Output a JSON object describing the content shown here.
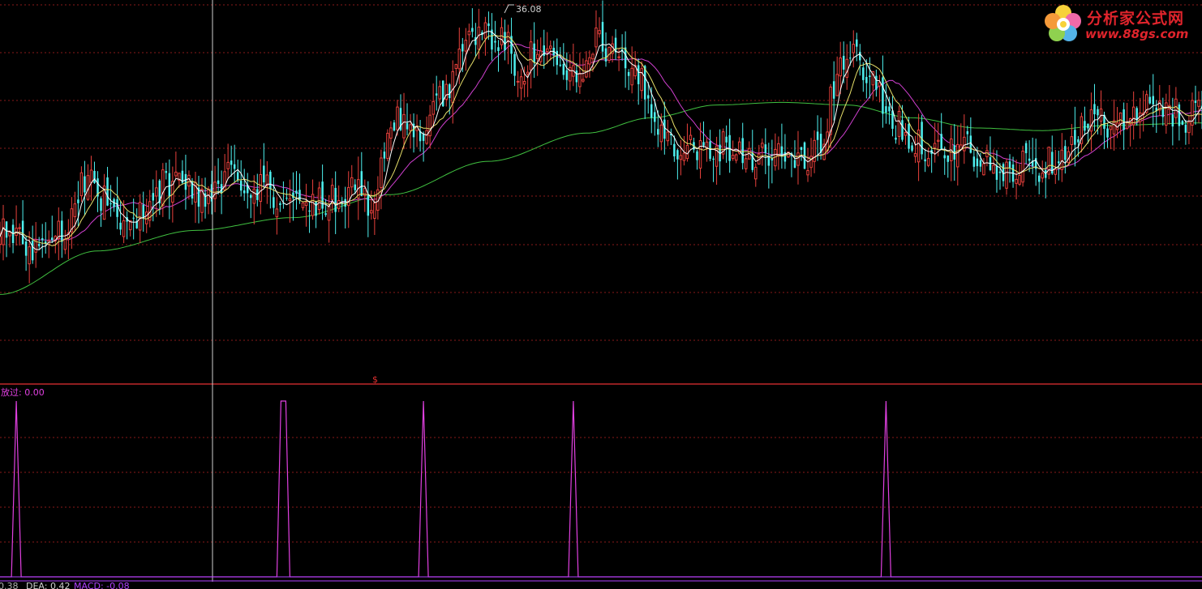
{
  "colors": {
    "background": "#000000",
    "grid": "#8a1a1a",
    "separator": "#c0282a",
    "candle_up": "#e8413c",
    "candle_down": "#4ef0ef",
    "ma5": "#ffffff",
    "ma10": "#e8e06a",
    "ma20": "#d040d0",
    "ma60": "#40c040",
    "indicator": "#e040e0",
    "macd_line": "#b040ff",
    "signal_marker": "#e03030"
  },
  "watermark": {
    "title": "分析家公式网",
    "url": "www.88gs.com"
  },
  "price_panel": {
    "peak_label": "36.08",
    "signal_marker": "$",
    "crosshair_index": 65
  },
  "indicator_panel": {
    "label": "放过: 0.00"
  },
  "footer": {
    "text_prefix": "0.38",
    "dea_label": "DEA: 0.42",
    "macd_label": "MACD: -0.08"
  },
  "chart_data": {
    "type": "line",
    "series_count": 370,
    "y_range": [
      22.0,
      37.0
    ],
    "candle_anchor_closes": [
      [
        0,
        28.2
      ],
      [
        5,
        27.6
      ],
      [
        10,
        27.4
      ],
      [
        20,
        28.2
      ],
      [
        27,
        30.2
      ],
      [
        32,
        29.2
      ],
      [
        40,
        28.0
      ],
      [
        47,
        29.6
      ],
      [
        55,
        30.0
      ],
      [
        62,
        29.3
      ],
      [
        72,
        30.1
      ],
      [
        80,
        29.8
      ],
      [
        88,
        28.9
      ],
      [
        95,
        29.2
      ],
      [
        103,
        29.2
      ],
      [
        110,
        30.1
      ],
      [
        114,
        28.5
      ],
      [
        118,
        31.4
      ],
      [
        124,
        32.6
      ],
      [
        130,
        31.6
      ],
      [
        136,
        33.2
      ],
      [
        142,
        35.4
      ],
      [
        148,
        35.6
      ],
      [
        155,
        35.3
      ],
      [
        160,
        34.3
      ],
      [
        166,
        35.3
      ],
      [
        172,
        34.1
      ],
      [
        178,
        33.8
      ],
      [
        184,
        35.4
      ],
      [
        190,
        34.6
      ],
      [
        196,
        33.8
      ],
      [
        202,
        32.3
      ],
      [
        208,
        31.4
      ],
      [
        215,
        31.2
      ],
      [
        222,
        31.3
      ],
      [
        230,
        31.0
      ],
      [
        238,
        31.0
      ],
      [
        246,
        30.7
      ],
      [
        252,
        31.2
      ],
      [
        256,
        33.4
      ],
      [
        260,
        35.0
      ],
      [
        266,
        34.2
      ],
      [
        270,
        33.3
      ],
      [
        276,
        32.0
      ],
      [
        282,
        31.4
      ],
      [
        288,
        31.1
      ],
      [
        295,
        31.3
      ],
      [
        302,
        30.6
      ],
      [
        308,
        30.1
      ],
      [
        314,
        30.7
      ],
      [
        320,
        30.5
      ],
      [
        326,
        31.2
      ],
      [
        332,
        32.0
      ],
      [
        338,
        32.3
      ],
      [
        345,
        32.1
      ],
      [
        352,
        32.7
      ],
      [
        358,
        32.8
      ],
      [
        363,
        32.4
      ],
      [
        369,
        33.0
      ]
    ],
    "ma60_anchors": [
      [
        0,
        25.5
      ],
      [
        30,
        27.2
      ],
      [
        60,
        28.0
      ],
      [
        90,
        28.5
      ],
      [
        120,
        29.4
      ],
      [
        150,
        30.7
      ],
      [
        180,
        31.8
      ],
      [
        200,
        32.4
      ],
      [
        220,
        32.9
      ],
      [
        240,
        33.0
      ],
      [
        260,
        32.9
      ],
      [
        280,
        32.4
      ],
      [
        300,
        32.0
      ],
      [
        320,
        31.9
      ],
      [
        340,
        32.1
      ],
      [
        369,
        32.2
      ]
    ],
    "indicator_spike_indices": [
      5,
      87,
      130,
      176,
      272
    ],
    "indicator_values": [
      "0",
      "1"
    ]
  }
}
